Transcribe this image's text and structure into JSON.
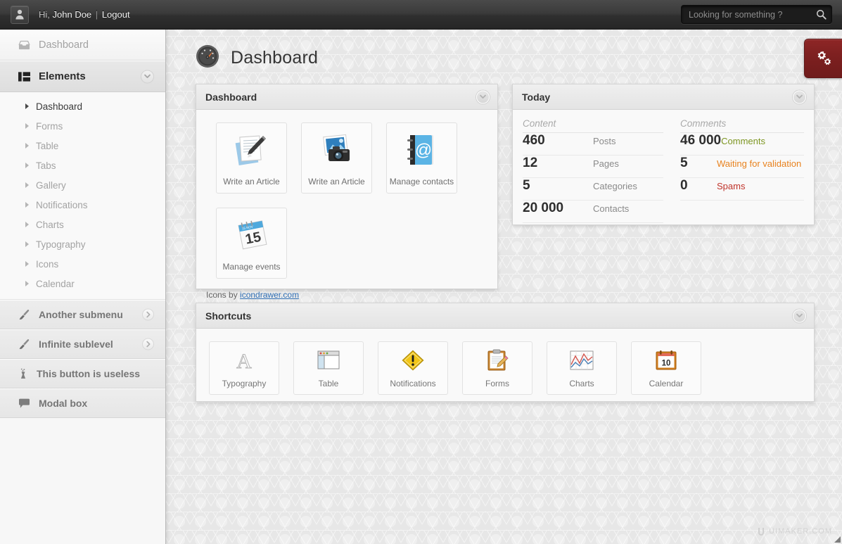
{
  "topbar": {
    "avatar_icon": "user-avatar-icon",
    "greeting_prefix": "Hi,",
    "user_name": "John Doe",
    "separator": "|",
    "logout_label": "Logout",
    "search_placeholder": "Looking for something ?",
    "search_value": "",
    "search_icon": "search-icon"
  },
  "sidebar": {
    "top_item": {
      "label": "Dashboard",
      "icon": "inbox-tray-icon"
    },
    "section": {
      "label": "Elements",
      "icon": "layout-blocks-icon",
      "toggle_icon": "chevron-down-icon"
    },
    "submenu": [
      {
        "label": "Dashboard",
        "active": true
      },
      {
        "label": "Forms",
        "active": false
      },
      {
        "label": "Table",
        "active": false
      },
      {
        "label": "Tabs",
        "active": false
      },
      {
        "label": "Gallery",
        "active": false
      },
      {
        "label": "Notifications",
        "active": false
      },
      {
        "label": "Charts",
        "active": false
      },
      {
        "label": "Typography",
        "active": false
      },
      {
        "label": "Icons",
        "active": false
      },
      {
        "label": "Calendar",
        "active": false
      }
    ],
    "rows": [
      {
        "label": "Another submenu",
        "icon": "brush-icon",
        "chevron": "chevron-right-icon"
      },
      {
        "label": "Infinite sublevel",
        "icon": "brush-icon",
        "chevron": "chevron-right-icon"
      },
      {
        "label": "This button is useless",
        "icon": "pin-icon",
        "chevron": ""
      },
      {
        "label": "Modal box",
        "icon": "speech-bubble-icon",
        "chevron": ""
      }
    ]
  },
  "page": {
    "title": "Dashboard",
    "title_icon": "speedometer-icon",
    "settings_button_icon": "gears-icon"
  },
  "dashboard_panel": {
    "title": "Dashboard",
    "toggle_icon": "chevron-down-icon",
    "tiles": [
      {
        "label": "Write an Article",
        "icon": "document-pen-icon"
      },
      {
        "label": "Write an Article",
        "icon": "camera-photo-icon"
      },
      {
        "label": "Manage contacts",
        "icon": "address-book-at-icon"
      },
      {
        "label": "Manage events",
        "icon": "calendar-15-icon"
      }
    ],
    "credit_prefix": "Icons by",
    "credit_link": "icondrawer.com"
  },
  "today_panel": {
    "title": "Today",
    "toggle_icon": "chevron-down-icon",
    "columns": [
      "Content",
      "Comments"
    ],
    "content_rows": [
      {
        "value": "460",
        "label": "Posts",
        "tone": "plain"
      },
      {
        "value": "12",
        "label": "Pages",
        "tone": "plain"
      },
      {
        "value": "5",
        "label": "Categories",
        "tone": "plain"
      },
      {
        "value": "20 000",
        "label": "Contacts",
        "tone": "plain"
      }
    ],
    "comment_rows": [
      {
        "value": "46 000",
        "label": "Comments",
        "tone": "green"
      },
      {
        "value": "5",
        "label": "Waiting for validation",
        "tone": "orange"
      },
      {
        "value": "0",
        "label": "Spams",
        "tone": "red"
      }
    ]
  },
  "shortcuts_panel": {
    "title": "Shortcuts",
    "toggle_icon": "chevron-down-icon",
    "items": [
      {
        "label": "Typography",
        "icon": "letter-a-icon"
      },
      {
        "label": "Table",
        "icon": "window-table-icon"
      },
      {
        "label": "Notifications",
        "icon": "warning-diamond-icon"
      },
      {
        "label": "Forms",
        "icon": "clipboard-pencil-icon"
      },
      {
        "label": "Charts",
        "icon": "line-chart-icon"
      },
      {
        "label": "Calendar",
        "icon": "calendar-10-icon"
      }
    ]
  },
  "watermark": {
    "text": "UIMAKER.COM",
    "logo_icon": "uimaker-logo-icon"
  },
  "colors": {
    "accent_red": "#7e2020",
    "link_blue": "#2f6fb5",
    "status_green": "#7d9622",
    "status_orange": "#e8821e",
    "status_red": "#c0342b",
    "topbar_dark": "#2f2f2f"
  }
}
